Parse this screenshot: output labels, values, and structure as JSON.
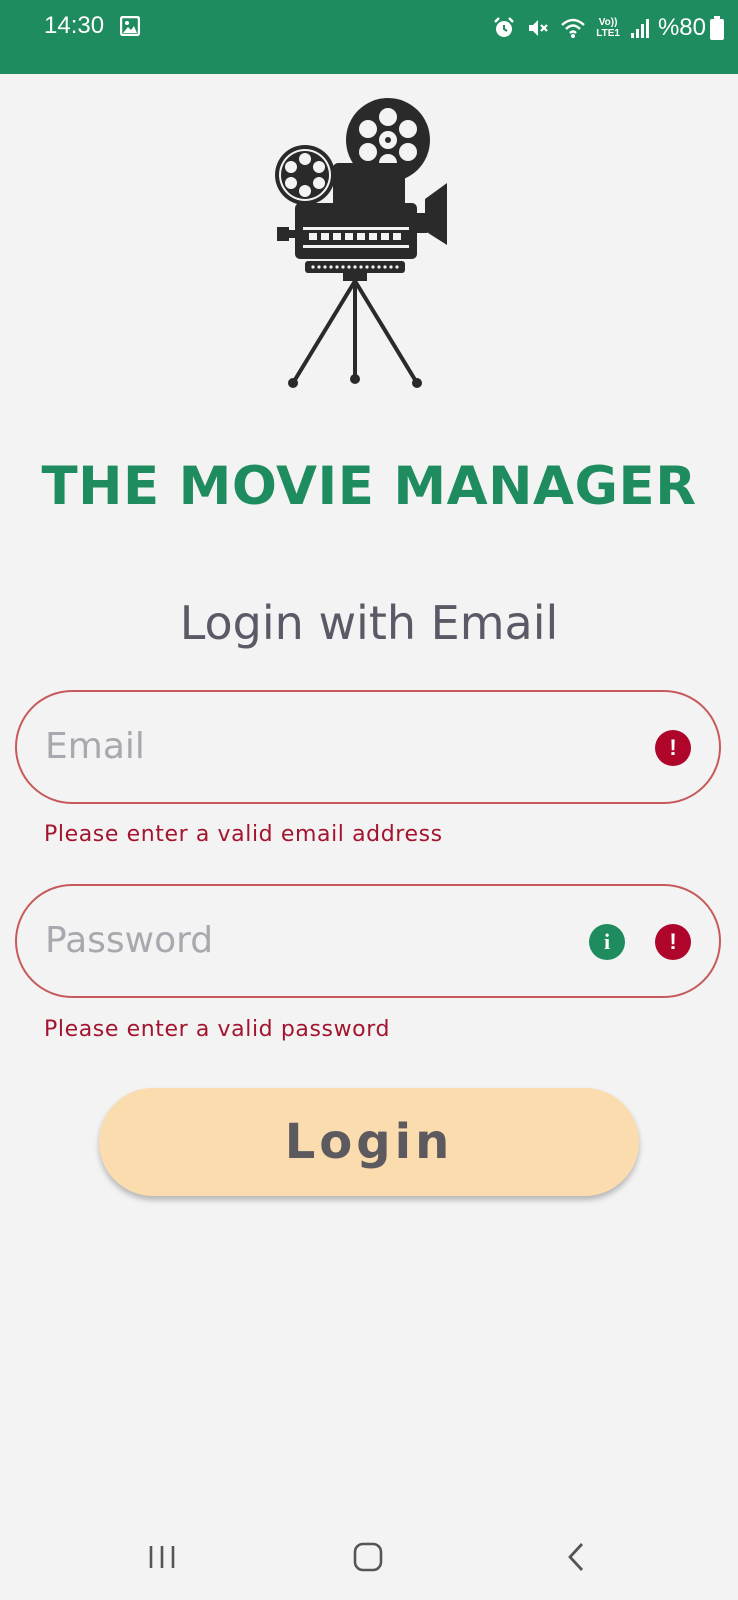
{
  "status_bar": {
    "time": "14:30",
    "battery": "%80",
    "network": "LTE1",
    "volte": "Vo))",
    "icons": [
      "image-icon",
      "alarm-icon",
      "mute-icon",
      "wifi-icon",
      "signal-icon",
      "battery-icon"
    ],
    "background_color": "#1e8c5e"
  },
  "logo": {
    "icon": "film-camera-icon"
  },
  "app_title": "THE MOVIE MANAGER",
  "subtitle": "Login with Email",
  "form": {
    "email": {
      "placeholder": "Email",
      "value": "",
      "error": "Please enter a valid email address",
      "icon": "error-icon"
    },
    "password": {
      "placeholder": "Password",
      "value": "",
      "error": "Please enter a valid password",
      "icons": [
        "info-icon",
        "error-icon"
      ]
    },
    "login_label": "Login"
  },
  "colors": {
    "brand": "#1e8c5e",
    "error": "#b0052b",
    "button": "#fadcae",
    "field_border": "#c75a5a"
  },
  "nav_bar": {
    "icons": [
      "recents-icon",
      "home-icon",
      "back-icon"
    ]
  }
}
